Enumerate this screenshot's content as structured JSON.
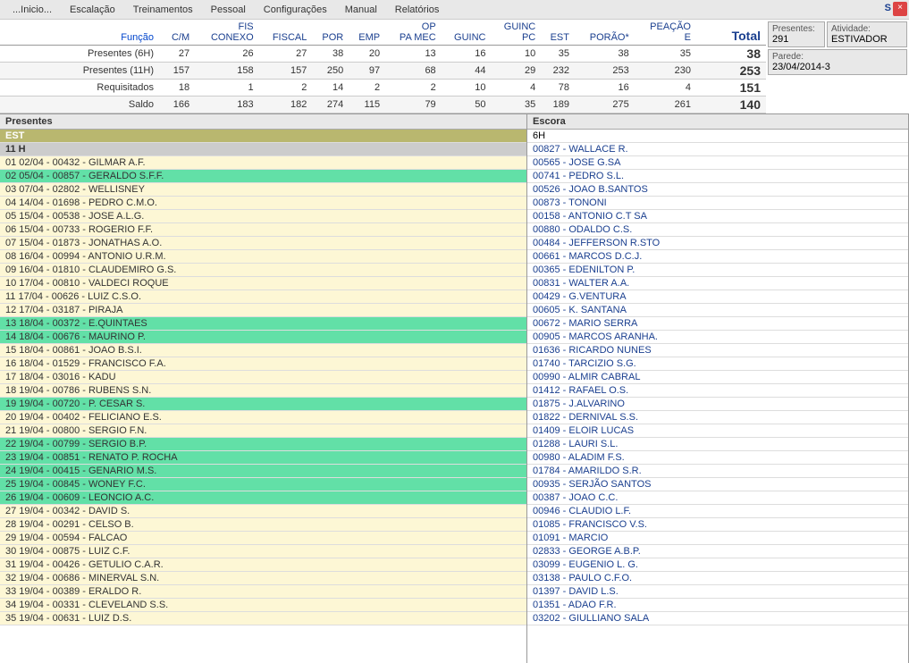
{
  "menu": {
    "items": [
      "...Inicio...",
      "Escalação",
      "Treinamentos",
      "Pessoal",
      "Configurações",
      "Manual",
      "Relatórios"
    ],
    "s": "S",
    "close": "×"
  },
  "summary": {
    "header_funcao": "Função",
    "columns": [
      "C/M",
      "FIS CONEXO",
      "FISCAL",
      "POR",
      "EMP",
      "OP PA MEC",
      "GUINC",
      "GUINC PC",
      "EST",
      "PORÃO*",
      "PEAÇÃO E"
    ],
    "total_label": "Total",
    "rows": [
      {
        "label": "Presentes (6H)",
        "v": [
          27,
          26,
          27,
          38,
          20,
          13,
          16,
          10,
          35,
          38,
          35
        ],
        "total": 38
      },
      {
        "label": "Presentes (11H)",
        "v": [
          157,
          158,
          157,
          250,
          97,
          68,
          44,
          29,
          232,
          253,
          230
        ],
        "total": 253
      },
      {
        "label": "Requisitados",
        "v": [
          18,
          1,
          2,
          14,
          2,
          2,
          10,
          4,
          78,
          16,
          4
        ],
        "total": 151
      },
      {
        "label": "Saldo",
        "v": [
          166,
          183,
          182,
          274,
          115,
          79,
          50,
          35,
          189,
          275,
          261
        ],
        "total": 140
      }
    ]
  },
  "sidebar": {
    "presentes_label": "Presentes:",
    "presentes_value": "291",
    "atividade_label": "Atividade:",
    "atividade_value": "ESTIVADOR",
    "parede_label": "Parede:",
    "parede_value": "23/04/2014-3"
  },
  "panels": {
    "left_title": "Presentes",
    "right_title": "Escora",
    "left_headers": {
      "est": "EST",
      "hour": "11 H"
    },
    "left_rows": [
      {
        "t": "01 02/04 - 00432 - GILMAR A.F.",
        "c": "y"
      },
      {
        "t": "02 05/04 - 00857 - GERALDO S.F.F.",
        "c": "g"
      },
      {
        "t": "03 07/04 - 02802 - WELLISNEY",
        "c": "y"
      },
      {
        "t": "04 14/04 - 01698 - PEDRO C.M.O.",
        "c": "y"
      },
      {
        "t": "05 15/04 - 00538 - JOSE A.L.G.",
        "c": "y"
      },
      {
        "t": "06 15/04 - 00733 - ROGERIO F.F.",
        "c": "y"
      },
      {
        "t": "07 15/04 - 01873 - JONATHAS A.O.",
        "c": "y"
      },
      {
        "t": "08 16/04 - 00994 - ANTONIO U.R.M.",
        "c": "y"
      },
      {
        "t": "09 16/04 - 01810 - CLAUDEMIRO G.S.",
        "c": "y"
      },
      {
        "t": "10 17/04 - 00810 - VALDECI ROQUE",
        "c": "y"
      },
      {
        "t": "11 17/04 - 00626 - LUIZ C.S.O.",
        "c": "y"
      },
      {
        "t": "12 17/04 - 03187 - PIRAJA",
        "c": "y"
      },
      {
        "t": "13 18/04 - 00372 - E.QUINTAES",
        "c": "g"
      },
      {
        "t": "14 18/04 - 00676 - MAURINO P.",
        "c": "g"
      },
      {
        "t": "15 18/04 - 00861 - JOAO B.S.I.",
        "c": "y"
      },
      {
        "t": "16 18/04 - 01529 - FRANCISCO F.A.",
        "c": "y"
      },
      {
        "t": "17 18/04 - 03016 - KADU",
        "c": "y"
      },
      {
        "t": "18 19/04 - 00786 - RUBENS S.N.",
        "c": "y"
      },
      {
        "t": "19 19/04 - 00720 - P. CESAR S.",
        "c": "g"
      },
      {
        "t": "20 19/04 - 00402 - FELICIANO E.S.",
        "c": "y"
      },
      {
        "t": "21 19/04 - 00800 - SERGIO F.N.",
        "c": "y"
      },
      {
        "t": "22 19/04 - 00799 - SERGIO B.P.",
        "c": "g"
      },
      {
        "t": "23 19/04 - 00851 - RENATO P. ROCHA",
        "c": "g"
      },
      {
        "t": "24 19/04 - 00415 - GENARIO M.S.",
        "c": "g"
      },
      {
        "t": "25 19/04 - 00845 - WONEY F.C.",
        "c": "g"
      },
      {
        "t": "26 19/04 - 00609 - LEONCIO A.C.",
        "c": "g"
      },
      {
        "t": "27 19/04 - 00342 - DAVID S.",
        "c": "y"
      },
      {
        "t": "28 19/04 - 00291 - CELSO B.",
        "c": "y"
      },
      {
        "t": "29 19/04 - 00594 - FALCAO",
        "c": "y"
      },
      {
        "t": "30 19/04 - 00875 - LUIZ C.F.",
        "c": "y"
      },
      {
        "t": "31 19/04 - 00426 - GETULIO C.A.R.",
        "c": "y"
      },
      {
        "t": "32 19/04 - 00686 - MINERVAL S.N.",
        "c": "y"
      },
      {
        "t": "33 19/04 - 00389 - ERALDO R.",
        "c": "y"
      },
      {
        "t": "34 19/04 - 00331 - CLEVELAND S.S.",
        "c": "y"
      },
      {
        "t": "35 19/04 - 00631 - LUIZ D.S.",
        "c": "y"
      }
    ],
    "right_header": "6H",
    "right_rows": [
      "00827 - WALLACE R.",
      "00565 - JOSE G.SA",
      "00741 - PEDRO S.L.",
      "00526 - JOAO B.SANTOS",
      "00873 - TONONI",
      "00158 - ANTONIO C.T SA",
      "00880 - ODALDO C.S.",
      "00484 - JEFFERSON R.STO",
      "00661 - MARCOS D.C.J.",
      "00365 - EDENILTON P.",
      "00831 - WALTER A.A.",
      "00429 - G.VENTURA",
      "00605 - K. SANTANA",
      "00672 - MARIO SERRA",
      "00905 - MARCOS ARANHA.",
      "01636 - RICARDO NUNES",
      "01740 - TARCIZIO S.G.",
      "00990 - ALMIR CABRAL",
      "01412 - RAFAEL O.S.",
      "01875 - J.ALVARINO",
      "01822 - DERNIVAL S.S.",
      "01409 - ELOIR LUCAS",
      "01288 - LAURI S.L.",
      "00980 - ALADIM F.S.",
      "01784 - AMARILDO S.R.",
      "00935 - SERJÃO SANTOS",
      "00387 - JOAO C.C.",
      "00946 - CLAUDIO L.F.",
      "01085 - FRANCISCO V.S.",
      "01091 - MARCIO",
      "02833 - GEORGE A.B.P.",
      "03099 - EUGENIO L. G.",
      "03138 - PAULO C.F.O.",
      "01397 - DAVID L.S.",
      "01351 - ADAO F.R.",
      "03202 - GIULLIANO SALA"
    ]
  }
}
